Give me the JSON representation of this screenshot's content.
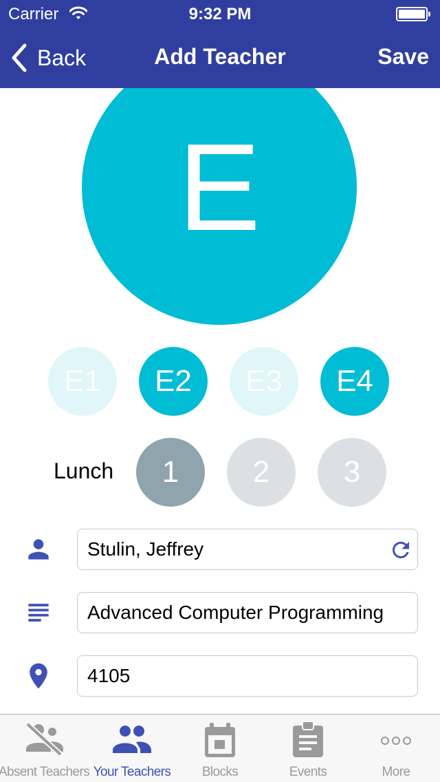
{
  "status_bar": {
    "carrier": "Carrier",
    "time": "9:32 PM"
  },
  "nav": {
    "back_label": "Back",
    "title": "Add Teacher",
    "save_label": "Save"
  },
  "avatar": {
    "letter": "E"
  },
  "blocks": [
    {
      "label": "E1",
      "selected": false
    },
    {
      "label": "E2",
      "selected": true
    },
    {
      "label": "E3",
      "selected": false
    },
    {
      "label": "E4",
      "selected": true
    }
  ],
  "lunch": {
    "label": "Lunch",
    "options": [
      {
        "label": "1",
        "selected": true
      },
      {
        "label": "2",
        "selected": false
      },
      {
        "label": "3",
        "selected": false
      }
    ]
  },
  "form": {
    "name": {
      "value": "Stulin, Jeffrey",
      "icon": "person-icon"
    },
    "course": {
      "value": "Advanced Computer Programming",
      "icon": "subject-icon"
    },
    "room": {
      "value": "4105",
      "icon": "location-pin-icon"
    }
  },
  "tabs": [
    {
      "label": "Absent Teachers",
      "icon": "absent-teachers-icon",
      "active": false
    },
    {
      "label": "Your Teachers",
      "icon": "people-icon",
      "active": true
    },
    {
      "label": "Blocks",
      "icon": "calendar-icon",
      "active": false
    },
    {
      "label": "Events",
      "icon": "clipboard-icon",
      "active": false
    },
    {
      "label": "More",
      "icon": "more-icon",
      "active": false
    }
  ],
  "colors": {
    "header": "#303F9F",
    "accent": "#00BCD4",
    "block_unselected": "#E0F6F8",
    "lunch_selected": "#90A4AE",
    "lunch_unselected": "#DCE0E3",
    "icon": "#3F51B5",
    "tab_active": "#3F51B5",
    "tab_inactive": "#9a9a9a"
  }
}
